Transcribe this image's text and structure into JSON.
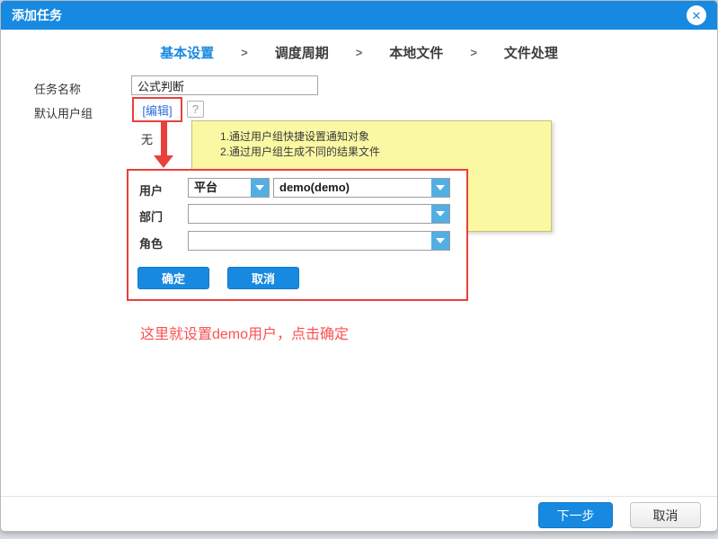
{
  "window": {
    "title": "添加任务",
    "close_icon": "✕"
  },
  "steps": {
    "separator": ">",
    "items": [
      {
        "label": "基本设置",
        "active": true
      },
      {
        "label": "调度周期",
        "active": false
      },
      {
        "label": "本地文件",
        "active": false
      },
      {
        "label": "文件处理",
        "active": false
      }
    ]
  },
  "form": {
    "task_name": {
      "label": "任务名称",
      "value": "公式判断"
    },
    "user_group": {
      "label": "默认用户组",
      "edit_link": "[编辑]",
      "help_label": "?",
      "current_value": "无"
    }
  },
  "tooltip": {
    "lines": [
      "1.通过用户组快捷设置通知对象",
      "2.通过用户组生成不同的结果文件"
    ]
  },
  "user_picker": {
    "rows": [
      {
        "label": "用户",
        "selects": [
          {
            "value": "平台"
          },
          {
            "value": "demo(demo)"
          }
        ]
      },
      {
        "label": "部门",
        "selects": [
          {
            "value": ""
          }
        ]
      },
      {
        "label": "角色",
        "selects": [
          {
            "value": ""
          }
        ]
      }
    ],
    "ok_label": "确定",
    "cancel_label": "取消"
  },
  "annotation": {
    "text": "这里就设置demo用户，点击确定"
  },
  "footer": {
    "next_label": "下一步",
    "cancel_label": "取消"
  },
  "colors": {
    "titlebar_blue": "#1789e0",
    "accent_blue": "#1789e0",
    "dropdown_arrow_blue": "#52aee5",
    "highlight_red": "#e8403a",
    "annotation_red": "#fb5050",
    "tooltip_yellow": "#fbf8a4"
  }
}
